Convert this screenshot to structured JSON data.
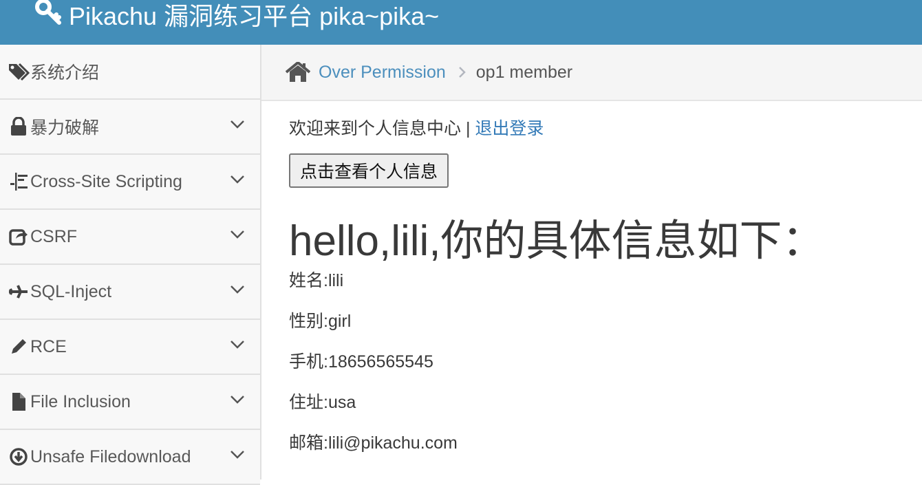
{
  "header": {
    "brand": "Pikachu 漏洞练习平台 pika~pika~"
  },
  "sidebar": {
    "items": [
      {
        "label": "系统介绍",
        "icon": "tags-icon",
        "expandable": false
      },
      {
        "label": "暴力破解",
        "icon": "lock-icon",
        "expandable": true
      },
      {
        "label": "Cross-Site Scripting",
        "icon": "align-icon",
        "expandable": true
      },
      {
        "label": "CSRF",
        "icon": "share-icon",
        "expandable": true
      },
      {
        "label": "SQL-Inject",
        "icon": "plane-icon",
        "expandable": true
      },
      {
        "label": "RCE",
        "icon": "pencil-icon",
        "expandable": true
      },
      {
        "label": "File Inclusion",
        "icon": "file-icon",
        "expandable": true
      },
      {
        "label": "Unsafe Filedownload",
        "icon": "download-icon",
        "expandable": true
      }
    ]
  },
  "breadcrumbs": {
    "link": "Over Permission",
    "active": "op1 member"
  },
  "main": {
    "welcome": "欢迎来到个人信息中心",
    "separator": "|",
    "logout": "退出登录",
    "view_button": "点击查看个人信息",
    "greeting": "hello,lili,你的具体信息如下：",
    "fields": [
      "姓名:lili",
      "性别:girl",
      "手机:18656565545",
      "住址:usa",
      "邮箱:lili@pikachu.com"
    ]
  },
  "colors": {
    "navbar": "#438eb9",
    "link": "#4c8fbd",
    "sidebar_bg": "#f8f8f8"
  }
}
